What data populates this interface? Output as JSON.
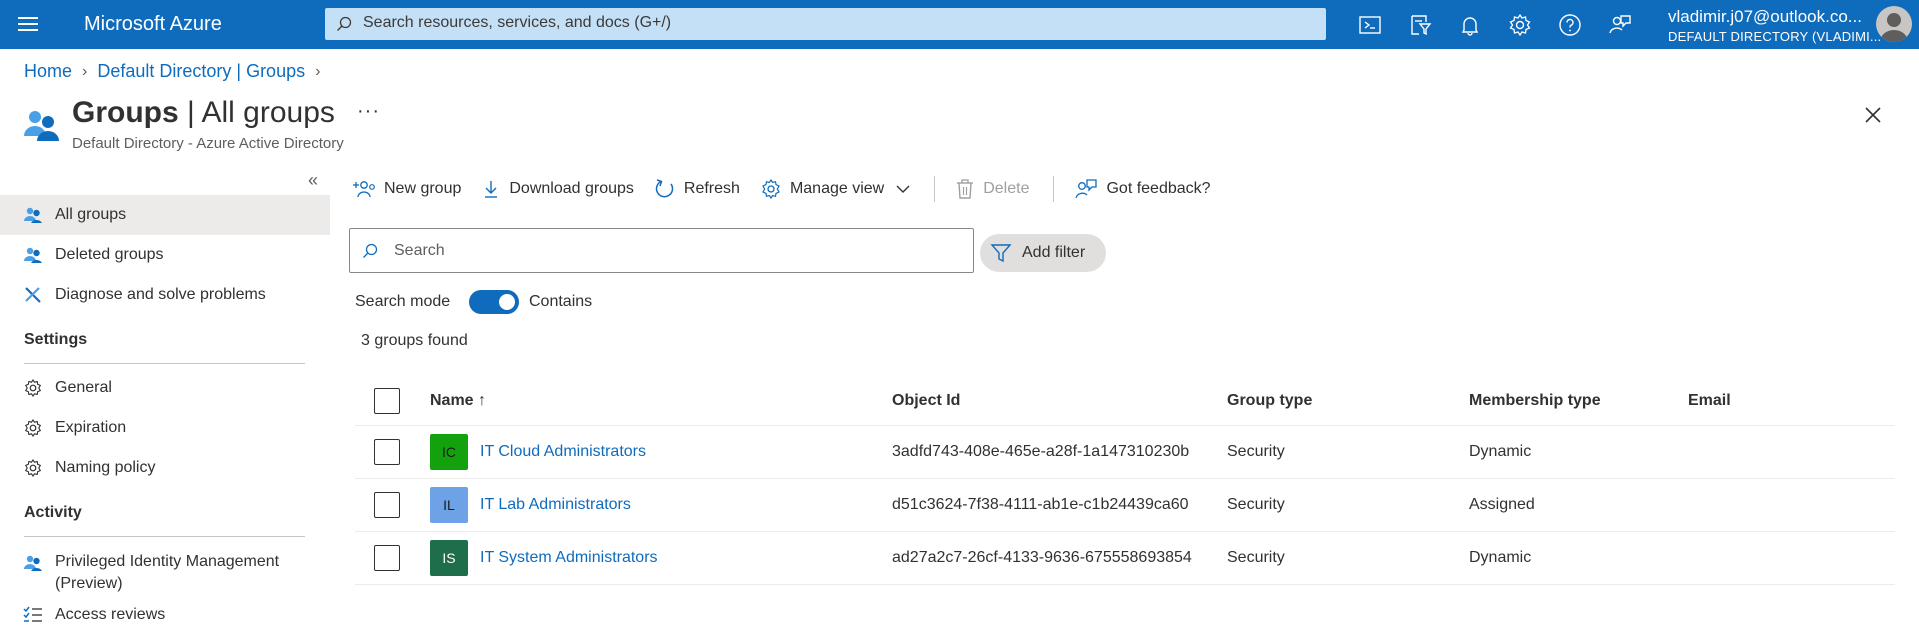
{
  "topbar": {
    "brand": "Microsoft Azure",
    "search_placeholder": "Search resources, services, and docs (G+/)",
    "icons": [
      "cloud-shell-icon",
      "directory-filter-icon",
      "notifications-bell-icon",
      "settings-gear-icon",
      "help-question-icon",
      "feedback-icon"
    ],
    "account_email": "vladimir.j07@outlook.co...",
    "account_directory": "DEFAULT DIRECTORY (VLADIMI..."
  },
  "breadcrumb": {
    "items": [
      "Home",
      "Default Directory | Groups"
    ]
  },
  "page": {
    "title_bold": "Groups",
    "title_rest": " | All groups",
    "subtitle": "Default Directory - Azure Active Directory",
    "more": "···"
  },
  "sidebar": {
    "collapse": "«",
    "top_items": [
      {
        "label": "All groups",
        "active": true
      },
      {
        "label": "Deleted groups"
      },
      {
        "label": "Diagnose and solve problems"
      }
    ],
    "settings_heading": "Settings",
    "settings_items": [
      {
        "label": "General"
      },
      {
        "label": "Expiration"
      },
      {
        "label": "Naming policy"
      }
    ],
    "activity_heading": "Activity",
    "activity_items": [
      {
        "label": "Privileged Identity Management (Preview)"
      },
      {
        "label": "Access reviews"
      }
    ]
  },
  "commands": {
    "new_group": "New group",
    "download_groups": "Download groups",
    "refresh": "Refresh",
    "manage_view": "Manage view",
    "delete": "Delete",
    "feedback": "Got feedback?"
  },
  "filter": {
    "search_placeholder": "Search",
    "add_filter": "Add filter",
    "search_mode_label": "Search mode",
    "search_mode_value": "Contains",
    "search_mode_on": true
  },
  "results": {
    "count_text": "3 groups found"
  },
  "table": {
    "columns": {
      "name": "Name ↑",
      "object_id": "Object Id",
      "group_type": "Group type",
      "membership_type": "Membership type",
      "email": "Email"
    },
    "rows": [
      {
        "initials": "IC",
        "icon_color": "#13a10e",
        "icon_text_color": "#1b1b1b",
        "name": "IT Cloud Administrators",
        "object_id": "3adfd743-408e-465e-a28f-1a147310230b",
        "group_type": "Security",
        "membership_type": "Dynamic",
        "email": ""
      },
      {
        "initials": "IL",
        "icon_color": "#6ea2e6",
        "icon_text_color": "#1b1b1b",
        "name": "IT Lab Administrators",
        "object_id": "d51c3624-7f38-4111-ab1e-c1b24439ca60",
        "group_type": "Security",
        "membership_type": "Assigned",
        "email": ""
      },
      {
        "initials": "IS",
        "icon_color": "#1e6e4a",
        "icon_text_color": "#ffffff",
        "name": "IT System Administrators",
        "object_id": "ad27a2c7-26cf-4133-9636-675558693854",
        "group_type": "Security",
        "membership_type": "Dynamic",
        "email": ""
      }
    ]
  },
  "colors": {
    "accent": "#0f6cbd",
    "search_bar": "#c4e0f7",
    "active_nav": "#edebe9"
  }
}
